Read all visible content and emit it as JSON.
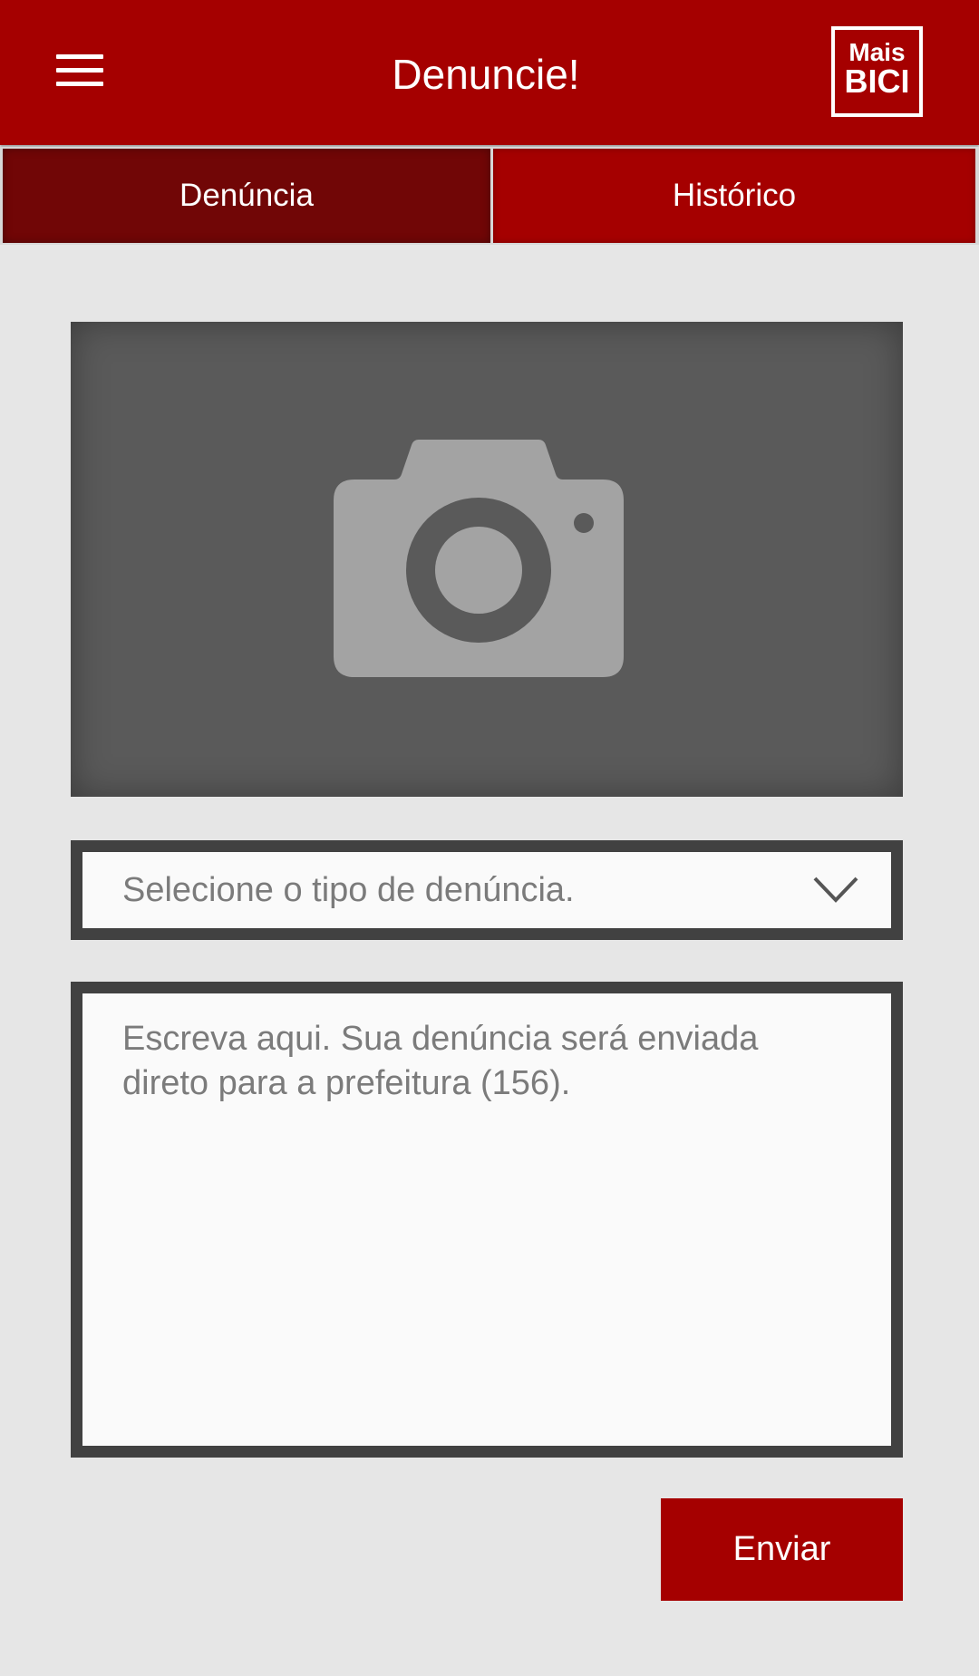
{
  "appbar": {
    "title": "Denuncie!",
    "menu_icon": "hamburger-menu-icon",
    "logo": {
      "line1": "Mais",
      "line2": "BICI"
    }
  },
  "tabs": [
    {
      "label": "Denúncia",
      "active": true
    },
    {
      "label": "Histórico",
      "active": false
    }
  ],
  "photo": {
    "icon": "camera-icon"
  },
  "report_type_select": {
    "placeholder": "Selecione o tipo de denúncia.",
    "icon": "chevron-down-icon"
  },
  "description": {
    "placeholder": "Escreva aqui. Sua denúncia será  enviada direto para a prefeitura (156)."
  },
  "send_button": {
    "label": "Enviar"
  },
  "colors": {
    "primary": "#a50000",
    "tab_active": "#710606",
    "background": "#e6e6e6",
    "field_border": "#414141",
    "photo_bg": "#5a5a5a",
    "icon_gray": "#a3a3a3",
    "placeholder_text": "#7b7b7b"
  }
}
